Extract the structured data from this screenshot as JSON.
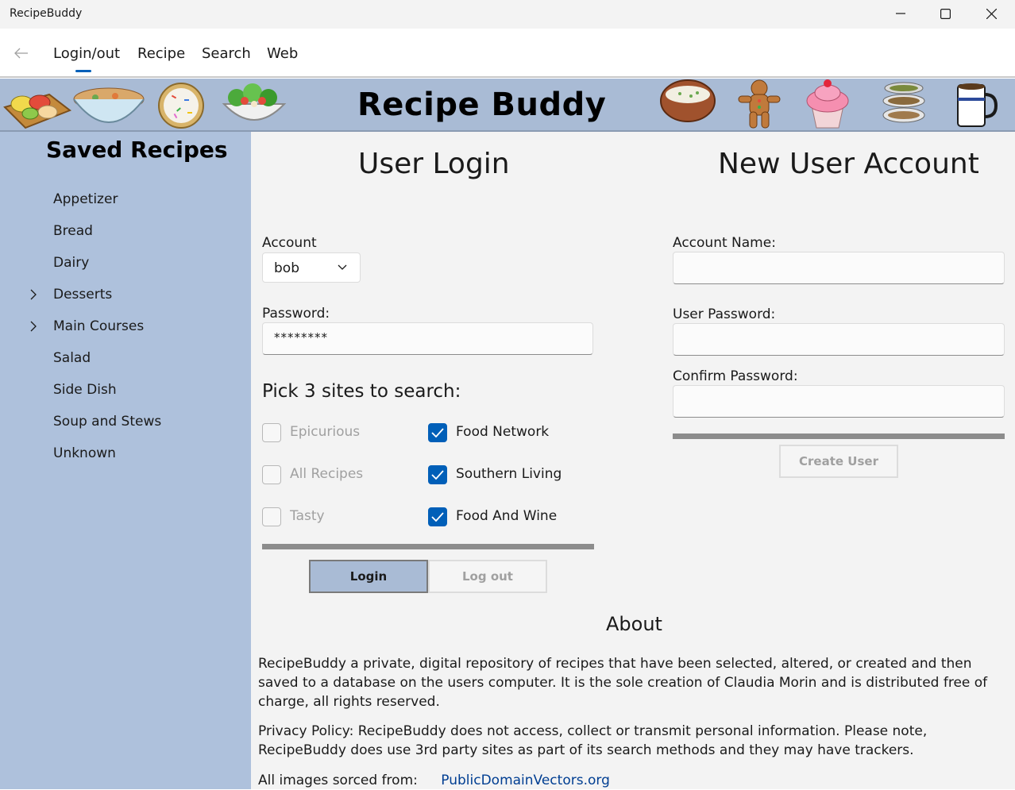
{
  "window": {
    "title": "RecipeBuddy"
  },
  "nav": {
    "tabs": [
      {
        "label": "Login/out"
      },
      {
        "label": "Recipe"
      },
      {
        "label": "Search"
      },
      {
        "label": "Web"
      }
    ],
    "active_tab": "Login/out"
  },
  "banner": {
    "title": "Recipe Buddy",
    "images": [
      "fruit-plate-icon",
      "soup-bowl-icon",
      "cookie-icon",
      "salad-icon",
      "clay-pot-icon",
      "gingerbread-man-icon",
      "cupcake-icon",
      "stacked-bowls-icon",
      "coffee-mug-icon"
    ]
  },
  "sidebar": {
    "title": "Saved Recipes",
    "items": [
      {
        "label": "Appetizer",
        "expandable": false
      },
      {
        "label": "Bread",
        "expandable": false
      },
      {
        "label": "Dairy",
        "expandable": false
      },
      {
        "label": "Desserts",
        "expandable": true
      },
      {
        "label": "Main Courses",
        "expandable": true
      },
      {
        "label": "Salad",
        "expandable": false
      },
      {
        "label": "Side Dish",
        "expandable": false
      },
      {
        "label": "Soup and Stews",
        "expandable": false
      },
      {
        "label": "Unknown",
        "expandable": false
      }
    ]
  },
  "login": {
    "title": "User Login",
    "account_label": "Account",
    "account_value": "bob",
    "password_label": "Password:",
    "password_value": "********",
    "sites_label": "Pick 3 sites to search:",
    "sites": [
      {
        "label": "Epicurious",
        "checked": false
      },
      {
        "label": "Food Network",
        "checked": true
      },
      {
        "label": "All Recipes",
        "checked": false
      },
      {
        "label": "Southern Living",
        "checked": true
      },
      {
        "label": "Tasty",
        "checked": false
      },
      {
        "label": "Food And Wine",
        "checked": true
      }
    ],
    "login_button": "Login",
    "logout_button": "Log out"
  },
  "new_account": {
    "title": "New User Account",
    "account_name_label": "Account Name:",
    "account_name_value": "",
    "user_password_label": "User  Password:",
    "user_password_value": "",
    "confirm_password_label": "Confirm Password:",
    "confirm_password_value": "",
    "create_button": "Create User"
  },
  "about": {
    "title": "About",
    "description": "RecipeBuddy a private, digital repository of recipes that have been selected, altered, or created and then saved to a database on the users computer.  It is the sole creation of Claudia Morin and is distributed free of charge, all rights reserved.",
    "privacy": "Privacy Policy:  RecipeBuddy does not access, collect or transmit personal information.  Please note, RecipeBuddy does use 3rd party sites as part of its search methods and they may have trackers.",
    "images_label": "All images sorced from:",
    "images_link": "PublicDomainVectors.org"
  },
  "colors": {
    "accent": "#005fb8",
    "banner_bg": "#a9bbd5",
    "sidebar_bg": "#aec1dc",
    "main_bg": "#f3f3f3"
  }
}
